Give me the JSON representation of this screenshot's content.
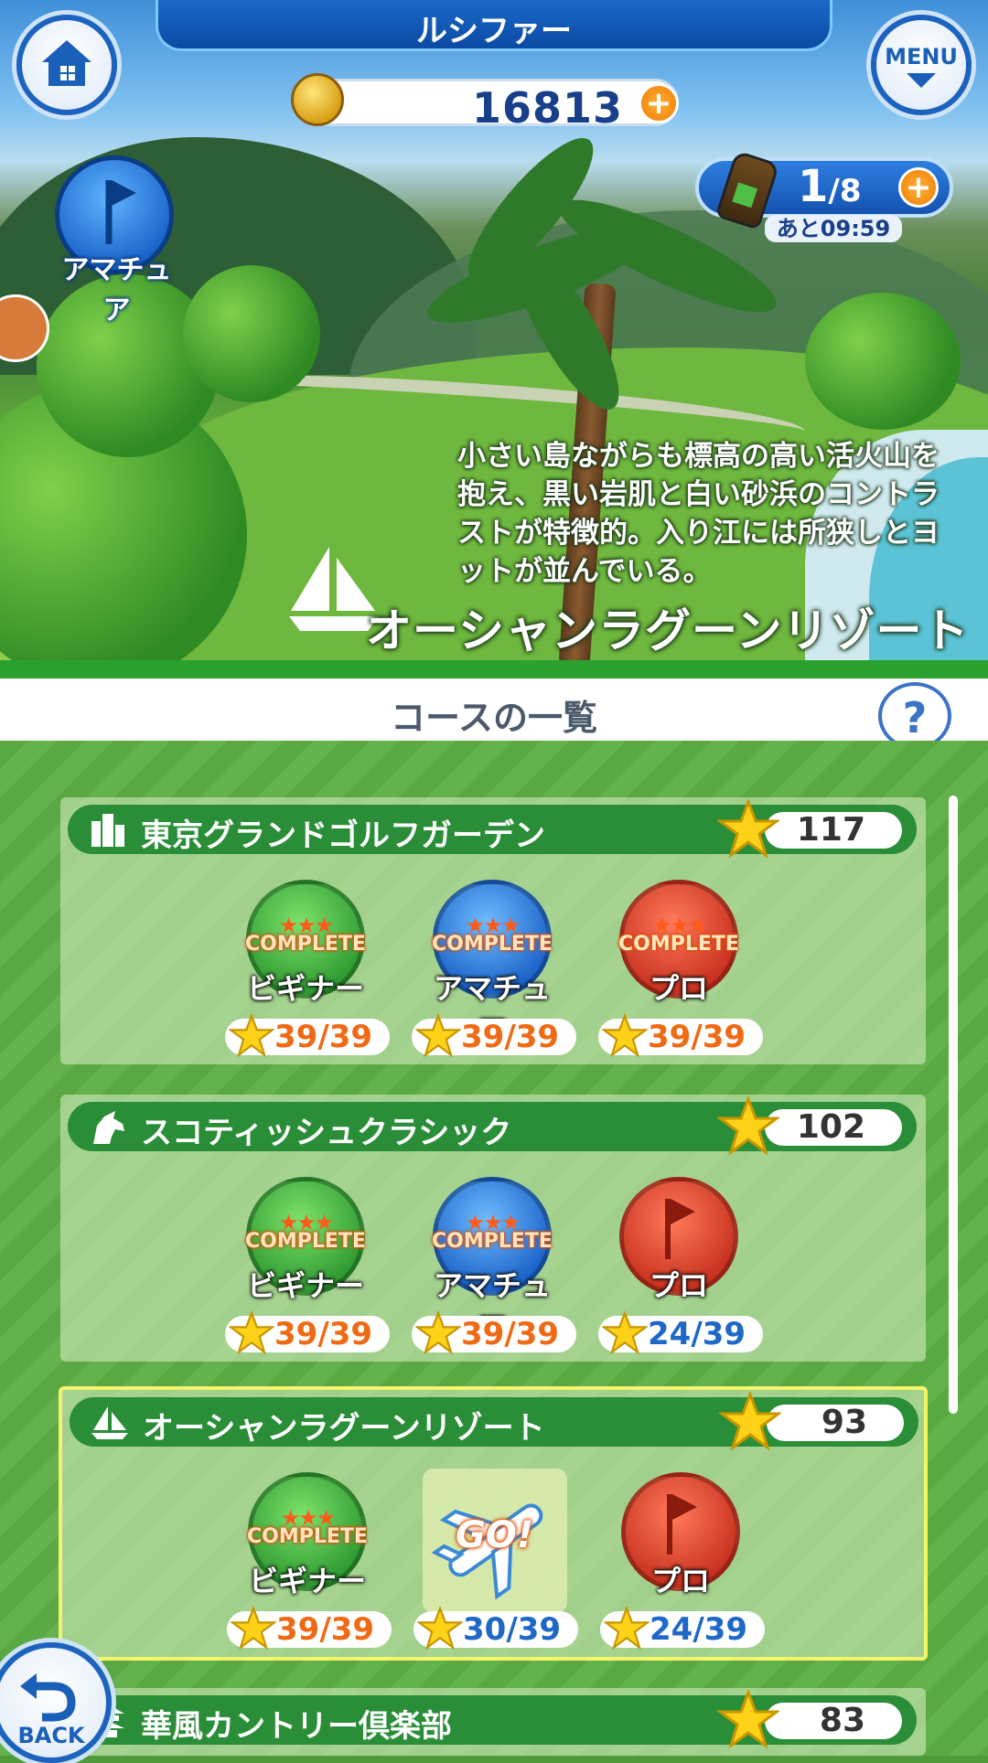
{
  "header": {
    "title": "ルシファー",
    "menu_label": "MENU",
    "back_label": "BACK",
    "coins": "16813",
    "stamina_current": "1",
    "stamina_max": "/8",
    "stamina_timer": "あと09:59",
    "rank_label": "アマチュア"
  },
  "hero": {
    "description": "小さい島ながらも標高の高い活火山を抱え、黒い岩肌と白い砂浜のコントラストが特徴的。入り江には所狭しとヨットが並んでいる。",
    "course_name": "オーシャンラグーンリゾート"
  },
  "list": {
    "title": "コースの一覧",
    "help_label": "?"
  },
  "colors": {
    "header_blue": "#1a69c9",
    "card_green": "#2a8d37",
    "count_orange": "#ef6a14",
    "count_blue": "#1f68c8",
    "selected_border": "#f5f56a"
  },
  "courses": [
    {
      "name": "東京グランドゴルフガーデン",
      "icon": "building-icon",
      "stars": "117",
      "levels": [
        {
          "label": "ビギナー",
          "complete": "COMPLETE",
          "count": "39/39"
        },
        {
          "label": "アマチュア",
          "complete": "COMPLETE",
          "count": "39/39"
        },
        {
          "label": "プロ",
          "complete": "COMPLETE",
          "count": "39/39"
        }
      ]
    },
    {
      "name": "スコティッシュクラシック",
      "icon": "unicorn-icon",
      "stars": "102",
      "levels": [
        {
          "label": "ビギナー",
          "complete": "COMPLETE",
          "count": "39/39"
        },
        {
          "label": "アマチュア",
          "complete": "COMPLETE",
          "count": "39/39"
        },
        {
          "label": "プロ",
          "complete": "",
          "count": "24/39"
        }
      ]
    },
    {
      "name": "オーシャンラグーンリゾート",
      "icon": "sailboat-icon",
      "stars": "93",
      "levels": [
        {
          "label": "ビギナー",
          "complete": "COMPLETE",
          "count": "39/39"
        },
        {
          "label": "GO!",
          "complete": "",
          "count": "30/39"
        },
        {
          "label": "プロ",
          "complete": "",
          "count": "24/39"
        }
      ]
    },
    {
      "name": "華風カントリー倶楽部",
      "icon": "pagoda-icon",
      "stars": "83"
    }
  ]
}
